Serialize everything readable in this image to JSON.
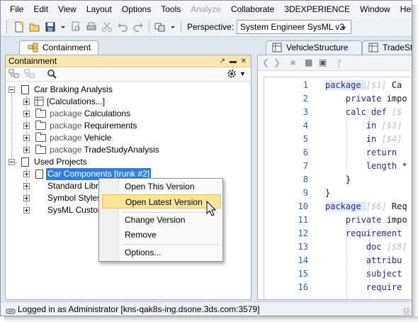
{
  "menubar": [
    "File",
    "Edit",
    "View",
    "Layout",
    "Options",
    "Tools",
    "Analyze",
    "Collaborate",
    "3DEXPERIENCE",
    "Window",
    "Help"
  ],
  "menubar_disabled_index": 6,
  "toolbar": {
    "perspective_label": "Perspective:",
    "perspective_value": "System Engineer SysML v2",
    "icons": [
      "new-icon",
      "open-icon",
      "save-icon",
      "dropdown-icon",
      "print-preview-icon",
      "print-icon",
      "cut-icon",
      "undo-icon",
      "redo-icon",
      "perspective-switch-icon"
    ]
  },
  "left_panel": {
    "tab_label": "Containment",
    "title": "Containment",
    "tree": [
      {
        "label": "Car Braking Analysis",
        "kind": "",
        "level": 0
      },
      {
        "label": "[Calculations...]",
        "kind": "",
        "level": 1
      },
      {
        "label": "Calculations",
        "kind": "package",
        "level": 1
      },
      {
        "label": "Requirements",
        "kind": "package",
        "level": 1
      },
      {
        "label": "Vehicle",
        "kind": "package",
        "level": 1
      },
      {
        "label": "TradeStudyAnalysis",
        "kind": "package",
        "level": 1
      },
      {
        "label": "Used Projects",
        "kind": "",
        "level": 0
      },
      {
        "label": "Car Components [trunk #2]",
        "kind": "",
        "level": 1,
        "selected": true
      },
      {
        "label": "Standard Libra",
        "kind": "",
        "level": 1
      },
      {
        "label": "Symbol Styles",
        "kind": "",
        "level": 1
      },
      {
        "label": "SysML Custom",
        "kind": "",
        "level": 1
      }
    ]
  },
  "right_panel": {
    "tabs": [
      "VehicleStructure",
      "TradeStruc"
    ],
    "code_lines": [
      {
        "n": "1",
        "parts": [
          [
            "k",
            "package "
          ],
          [
            "m",
            "[$1] "
          ],
          [
            "t",
            "Ca"
          ]
        ]
      },
      {
        "n": "2",
        "parts": [
          [
            "t",
            "    "
          ],
          [
            "k",
            "private "
          ],
          [
            "t",
            "impo"
          ]
        ]
      },
      {
        "n": "3",
        "parts": [
          [
            "t",
            "    "
          ],
          [
            "k",
            "calc def "
          ],
          [
            "m",
            "[$"
          ]
        ]
      },
      {
        "n": "4",
        "parts": [
          [
            "t",
            "        "
          ],
          [
            "k",
            "in "
          ],
          [
            "m",
            "[$3]"
          ]
        ]
      },
      {
        "n": "5",
        "parts": [
          [
            "t",
            "        "
          ],
          [
            "k",
            "in "
          ],
          [
            "m",
            "[$4]"
          ]
        ]
      },
      {
        "n": "6",
        "parts": [
          [
            "t",
            "        "
          ],
          [
            "k",
            "return "
          ]
        ]
      },
      {
        "n": "7",
        "parts": [
          [
            "t",
            "        "
          ],
          [
            "k",
            "length "
          ],
          [
            "t",
            "*"
          ]
        ]
      },
      {
        "n": "8",
        "parts": [
          [
            "t",
            "    }"
          ]
        ]
      },
      {
        "n": "9",
        "parts": [
          [
            "t",
            "}"
          ]
        ]
      },
      {
        "n": "10",
        "parts": [
          [
            "k",
            "package "
          ],
          [
            "m",
            "[$6] "
          ],
          [
            "t",
            "Req"
          ]
        ]
      },
      {
        "n": "11",
        "parts": [
          [
            "t",
            "    "
          ],
          [
            "k",
            "private "
          ],
          [
            "t",
            "impo"
          ]
        ]
      },
      {
        "n": "12",
        "parts": [
          [
            "t",
            "    "
          ],
          [
            "k",
            "requirement "
          ]
        ]
      },
      {
        "n": "13",
        "parts": [
          [
            "t",
            "        "
          ],
          [
            "k",
            "doc "
          ],
          [
            "m",
            "[$8]"
          ]
        ]
      },
      {
        "n": "14",
        "parts": [
          [
            "t",
            "        "
          ],
          [
            "k",
            "attribu"
          ]
        ]
      },
      {
        "n": "15",
        "parts": [
          [
            "t",
            "        "
          ],
          [
            "k",
            "subject"
          ]
        ]
      },
      {
        "n": "16",
        "parts": [
          [
            "t",
            "        "
          ],
          [
            "k",
            "require"
          ]
        ]
      }
    ]
  },
  "context_menu": {
    "items": [
      "Open This Version",
      "Open Latest Version",
      "Change Version",
      "Remove",
      "Options..."
    ],
    "active_index": 1
  },
  "status": {
    "text": "Logged in as Administrator [kns-qak8s-ing.dsone.3ds.com:3579]"
  },
  "colors": {
    "selection": "#2e7fd8",
    "panel_title": "#fbe6b2",
    "menu_highlight": "#fbe39a",
    "keyword": "#2a2a9c"
  }
}
